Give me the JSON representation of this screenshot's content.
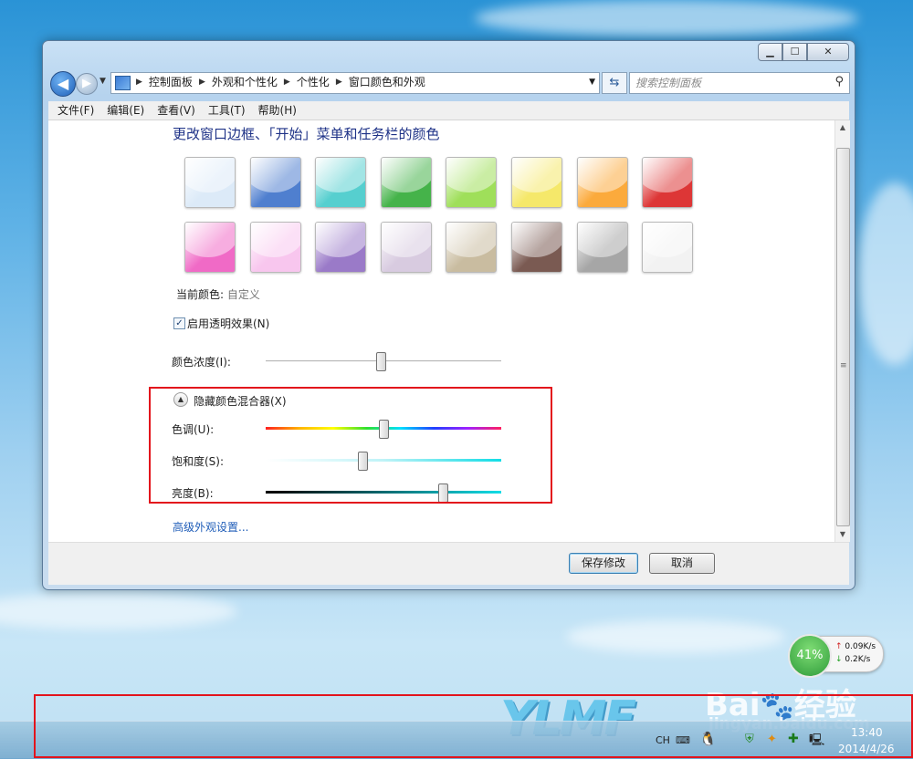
{
  "window": {
    "controls": {
      "minimize": "▁",
      "maximize": "☐",
      "close": "✕"
    }
  },
  "nav": {
    "back": "◀",
    "forward": "▶",
    "breadcrumbs": [
      "控制面板",
      "外观和个性化",
      "个性化",
      "窗口颜色和外观"
    ],
    "search_placeholder": "搜索控制面板"
  },
  "menu": [
    "文件(F)",
    "编辑(E)",
    "查看(V)",
    "工具(T)",
    "帮助(H)"
  ],
  "page": {
    "title": "更改窗口边框、「开始」菜单和任务栏的颜色",
    "swatch_colors": [
      [
        "#dceaf8",
        "#4f7fcf",
        "#56cfcf",
        "#45b34a",
        "#9fdf5a",
        "#f5e86a",
        "#fbaa3c",
        "#dd3636"
      ],
      [
        "#f06ac6",
        "#f8c6ee",
        "#9a7ac8",
        "#d8cbe0",
        "#c9bca0",
        "#7a5a52",
        "#a6a6a6",
        "#f2f2f2"
      ]
    ],
    "current_color_label": "当前颜色:",
    "current_color_value": "自定义",
    "transparency_label": "启用透明效果(N)",
    "transparency_checked": true,
    "intensity_label": "颜色浓度(I):",
    "intensity_value": 0.49,
    "mixer_toggle_label": "隐藏颜色混合器(X)",
    "hue_label": "色调(U):",
    "hue_value": 0.5,
    "saturation_label": "饱和度(S):",
    "saturation_value": 0.41,
    "brightness_label": "亮度(B):",
    "brightness_value": 0.75,
    "advanced_link": "高级外观设置..."
  },
  "footer": {
    "save": "保存修改",
    "cancel": "取消"
  },
  "widget": {
    "percent": "41%",
    "up": "0.09K/s",
    "down": "0.2K/s"
  },
  "tray": {
    "lang": "CH",
    "time": "13:40",
    "date": "2014/4/26"
  },
  "watermark": {
    "brand": "Bai",
    "brand_cn": "经验",
    "url": "jingyan.baidu.com",
    "logo": "YLMF"
  },
  "colors": {
    "highlight": "#e3141c",
    "title": "#1e3287",
    "link": "#1f5db8"
  }
}
